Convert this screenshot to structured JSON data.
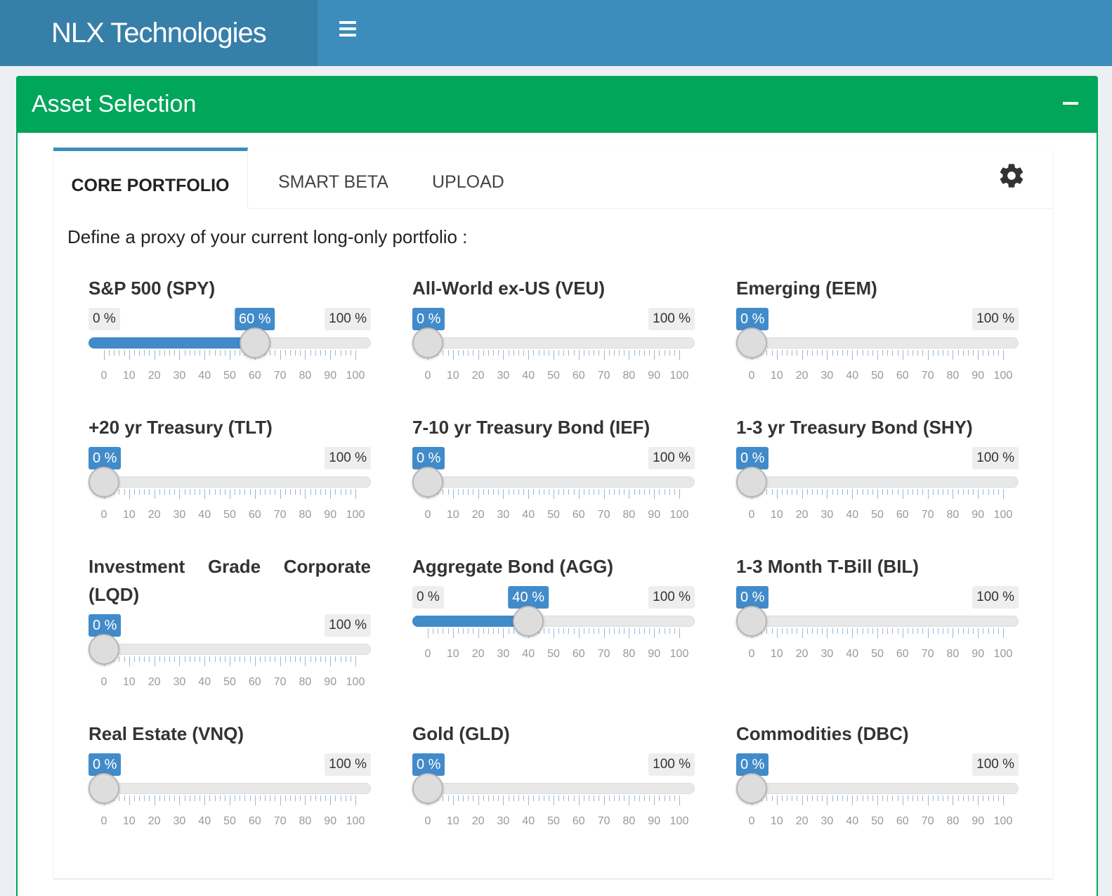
{
  "header": {
    "brand": "NLX Technologies"
  },
  "box": {
    "title": "Asset Selection"
  },
  "tabs": [
    {
      "label": "CORE PORTFOLIO",
      "active": true
    },
    {
      "label": "SMART BETA",
      "active": false
    },
    {
      "label": "UPLOAD",
      "active": false
    }
  ],
  "intro": "Define a proxy of your current long-only portfolio :",
  "slider_labels": {
    "min": "0 %",
    "max": "100 %",
    "ticks": [
      "0",
      "10",
      "20",
      "30",
      "40",
      "50",
      "60",
      "70",
      "80",
      "90",
      "100"
    ]
  },
  "sliders": [
    {
      "label": "S&P 500 (SPY)",
      "value": 60,
      "value_text": "60 %"
    },
    {
      "label": "All-World ex-US (VEU)",
      "value": 0,
      "value_text": "0 %"
    },
    {
      "label": "Emerging (EEM)",
      "value": 0,
      "value_text": "0 %"
    },
    {
      "label": "+20 yr Treasury (TLT)",
      "value": 0,
      "value_text": "0 %"
    },
    {
      "label": "7-10 yr Treasury Bond (IEF)",
      "value": 0,
      "value_text": "0 %"
    },
    {
      "label": "1-3 yr Treasury Bond (SHY)",
      "value": 0,
      "value_text": "0 %"
    },
    {
      "label": "Investment Grade Corporate (LQD)",
      "value": 0,
      "value_text": "0 %"
    },
    {
      "label": "Aggregate Bond (AGG)",
      "value": 40,
      "value_text": "40 %"
    },
    {
      "label": "1-3 Month T-Bill (BIL)",
      "value": 0,
      "value_text": "0 %"
    },
    {
      "label": "Real Estate (VNQ)",
      "value": 0,
      "value_text": "0 %"
    },
    {
      "label": "Gold (GLD)",
      "value": 0,
      "value_text": "0 %"
    },
    {
      "label": "Commodities (DBC)",
      "value": 0,
      "value_text": "0 %"
    }
  ],
  "colors": {
    "header": "#3c8dbc",
    "brand_bg": "#367fa9",
    "box_header": "#00a65a",
    "slider_fill": "#428bca"
  }
}
